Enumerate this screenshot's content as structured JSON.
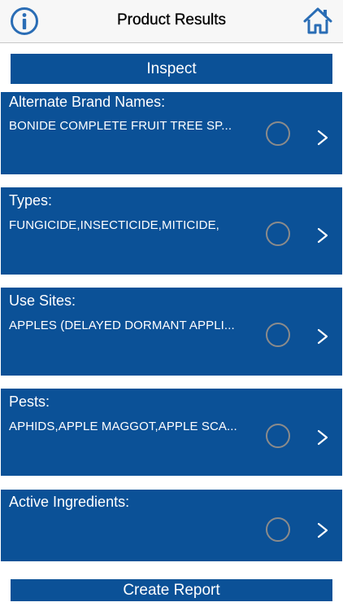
{
  "nav": {
    "title": "Product Results",
    "left_icon": "info-icon",
    "right_icon": "home-icon"
  },
  "inspect_label": "Inspect",
  "cards": [
    {
      "label": "Alternate Brand Names:",
      "value": "BONIDE COMPLETE FRUIT TREE SP..."
    },
    {
      "label": "Types:",
      "value": "FUNGICIDE,INSECTICIDE,MITICIDE,"
    },
    {
      "label": "Use Sites:",
      "value": "APPLES (DELAYED DORMANT APPLI..."
    },
    {
      "label": "Pests:",
      "value": "APHIDS,APPLE MAGGOT,APPLE SCA..."
    },
    {
      "label": "Active Ingredients:",
      "value": ""
    }
  ],
  "chevron_glyph": ">",
  "report_label": "Create Report",
  "colors": {
    "accent": "#0b5197",
    "icon_blue": "#2a6db5",
    "radio_gray": "#8b8b8b"
  }
}
